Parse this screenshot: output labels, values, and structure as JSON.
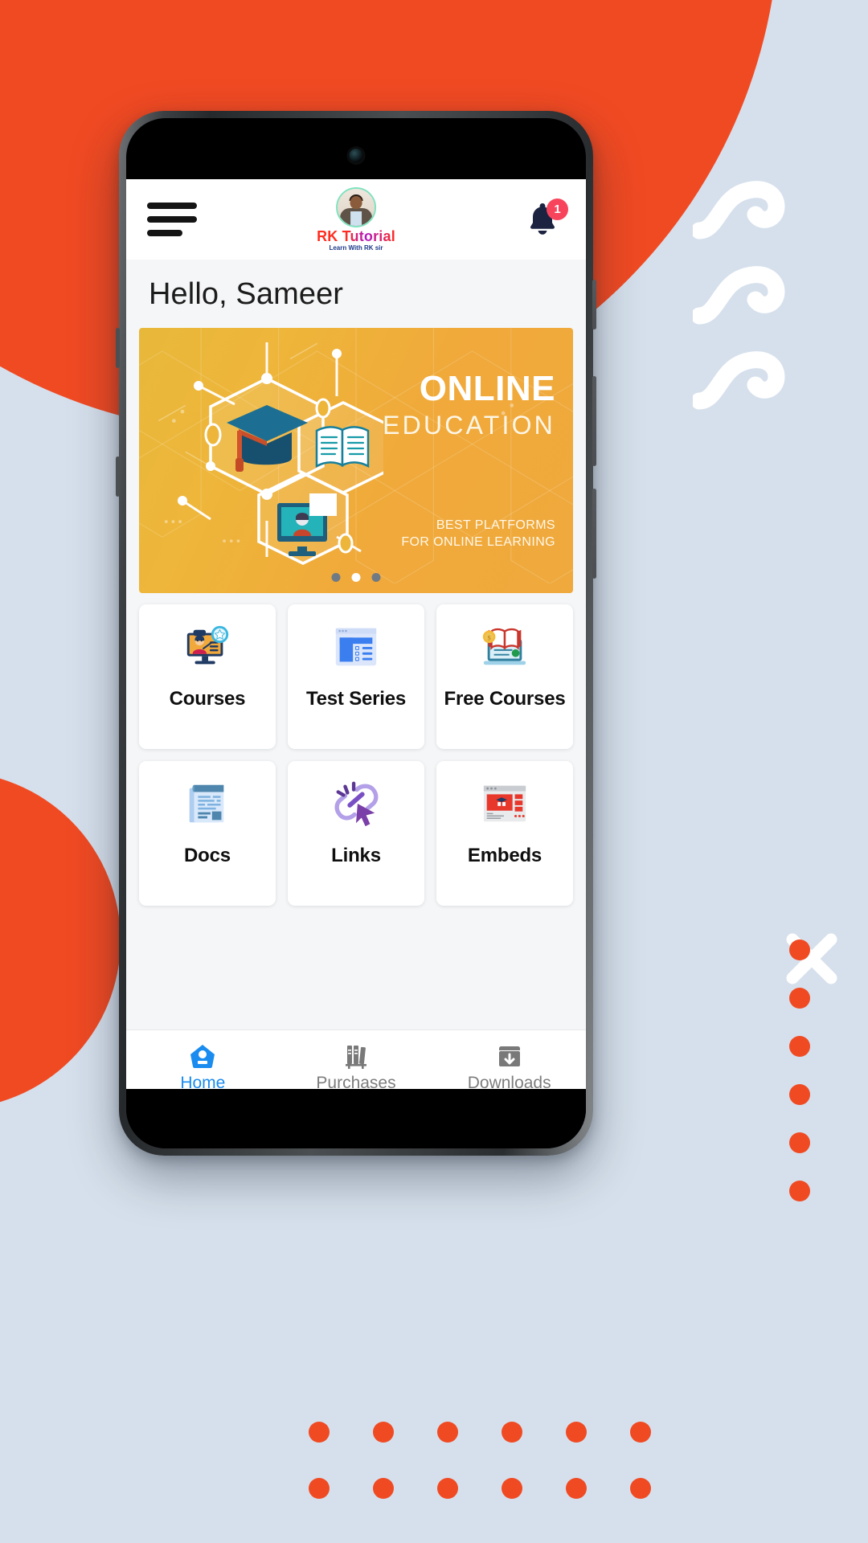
{
  "colors": {
    "accent_orange": "#f04a23",
    "page_bg": "#d6e0ec",
    "screen_bg": "#f5f6f7",
    "nav_active": "#1a8cf0",
    "nav_inactive": "#7d7d7d",
    "badge_red": "#f7445c",
    "banner_orange": "#efa93c"
  },
  "appbar": {
    "menu_icon": "hamburger-menu-icon",
    "brand_name": "RK Tutorial",
    "brand_tagline": "Learn With RK sir",
    "brand_avatar_icon": "profile-photo-avatar",
    "bell_icon": "notification-bell-icon",
    "bell_badge_count": "1"
  },
  "greeting": {
    "text": "Hello, Sameer"
  },
  "banner": {
    "title": "ONLINE",
    "subtitle": "EDUCATION",
    "caption_line1": "BEST PLATFORMS",
    "caption_line2": "FOR ONLINE LEARNING",
    "illustration_icons": [
      "graduation-cap-icon",
      "open-book-icon",
      "video-lecture-monitor-icon"
    ],
    "carousel": {
      "total": 3,
      "active_index": 1
    }
  },
  "tiles": [
    {
      "label": "Courses",
      "icon": "teacher-on-monitor-icon",
      "name": "tile-courses"
    },
    {
      "label": "Test Series",
      "icon": "test-list-window-icon",
      "name": "tile-test-series"
    },
    {
      "label": "Free Courses",
      "icon": "laptop-book-coin-icon",
      "name": "tile-free-courses"
    },
    {
      "label": "Docs",
      "icon": "document-pages-icon",
      "name": "tile-docs"
    },
    {
      "label": "Links",
      "icon": "link-cursor-icon",
      "name": "tile-links"
    },
    {
      "label": "Embeds",
      "icon": "browser-embed-icon",
      "name": "tile-embeds"
    }
  ],
  "bottom_nav": [
    {
      "label": "Home",
      "icon": "home-icon",
      "active": true
    },
    {
      "label": "Purchases",
      "icon": "books-shelf-icon",
      "active": false
    },
    {
      "label": "Downloads",
      "icon": "download-box-icon",
      "active": false
    }
  ]
}
